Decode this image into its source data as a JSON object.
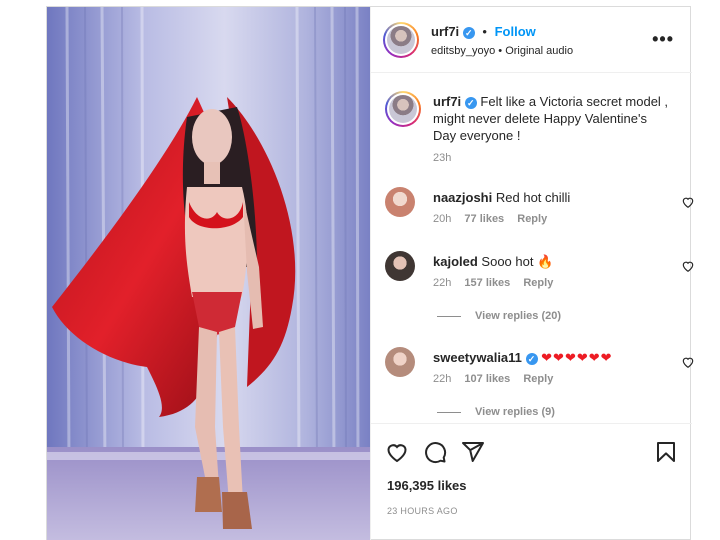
{
  "post": {
    "author": {
      "username": "urf7i",
      "follow_label": "Follow",
      "dot": "•",
      "audio_creator": "editsby_yoyo",
      "audio_label": "Original audio"
    },
    "more_label": "•••",
    "caption": {
      "username": "urf7i",
      "text": "Felt like a Victoria secret model , might never delete Happy Valentine's Day everyone !",
      "time": "23h"
    },
    "comments": [
      {
        "username": "naazjoshi",
        "text": "Red hot chilli",
        "time": "20h",
        "likes": "77 likes",
        "reply_label": "Reply",
        "avatar_color": "#c9826f"
      },
      {
        "username": "kajoled",
        "text": "Sooo hot 🔥",
        "time": "22h",
        "likes": "157 likes",
        "reply_label": "Reply",
        "avatar_color": "#3f3633",
        "replies": "View replies (20)"
      },
      {
        "username": "sweetywalia11",
        "text": "",
        "emoji_hearts": "❤❤❤❤❤❤",
        "time": "22h",
        "likes": "107 likes",
        "reply_label": "Reply",
        "avatar_color": "#b58c7c",
        "replies": "View replies (9)"
      }
    ],
    "likes": "196,395 likes",
    "posted_ago": "23 HOURS AGO"
  },
  "icons": [
    "heart-icon",
    "comment-icon",
    "share-icon",
    "bookmark-icon",
    "more-icon",
    "verified-icon"
  ],
  "colors": {
    "accent": "#0095f6",
    "verified": "#3897f0",
    "heart_red": "#ed1c24",
    "muted": "#8e8e8e"
  }
}
